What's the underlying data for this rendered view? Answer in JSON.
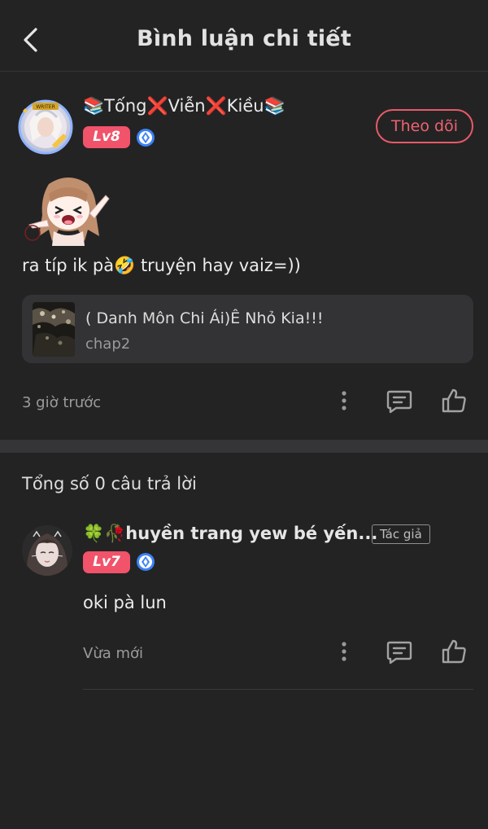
{
  "header": {
    "title": "Bình luận chi tiết"
  },
  "comment": {
    "username": "📚Tống❌Viễn❌Kiều📚",
    "level": "Lv8",
    "follow_label": "Theo dõi",
    "text": "ra típ ik pà🤣 truyện hay vaiz=))",
    "time": "3 giờ trước",
    "story": {
      "title": "( Danh Môn Chi Ái)Ê Nhỏ Kia!!!",
      "chapter": "chap2"
    }
  },
  "replies_summary": "Tổng số 0 câu trả lời",
  "reply": {
    "username": "🍀🥀huyền trang yew bé yến...",
    "level": "Lv7",
    "author_tag": "Tác giả",
    "text": "oki pà lun",
    "time": "Vừa mới"
  },
  "icons": {
    "back": "chevron-left-icon",
    "vip": "diamond-badge-icon",
    "more": "more-vertical-icon",
    "reply": "comment-icon",
    "like": "thumbs-up-icon"
  },
  "colors": {
    "background": "#232324",
    "accent": "#ef6270",
    "level_badge": "#f0536a",
    "vip_badge": "#3b82f6",
    "card_bg": "#333335"
  }
}
